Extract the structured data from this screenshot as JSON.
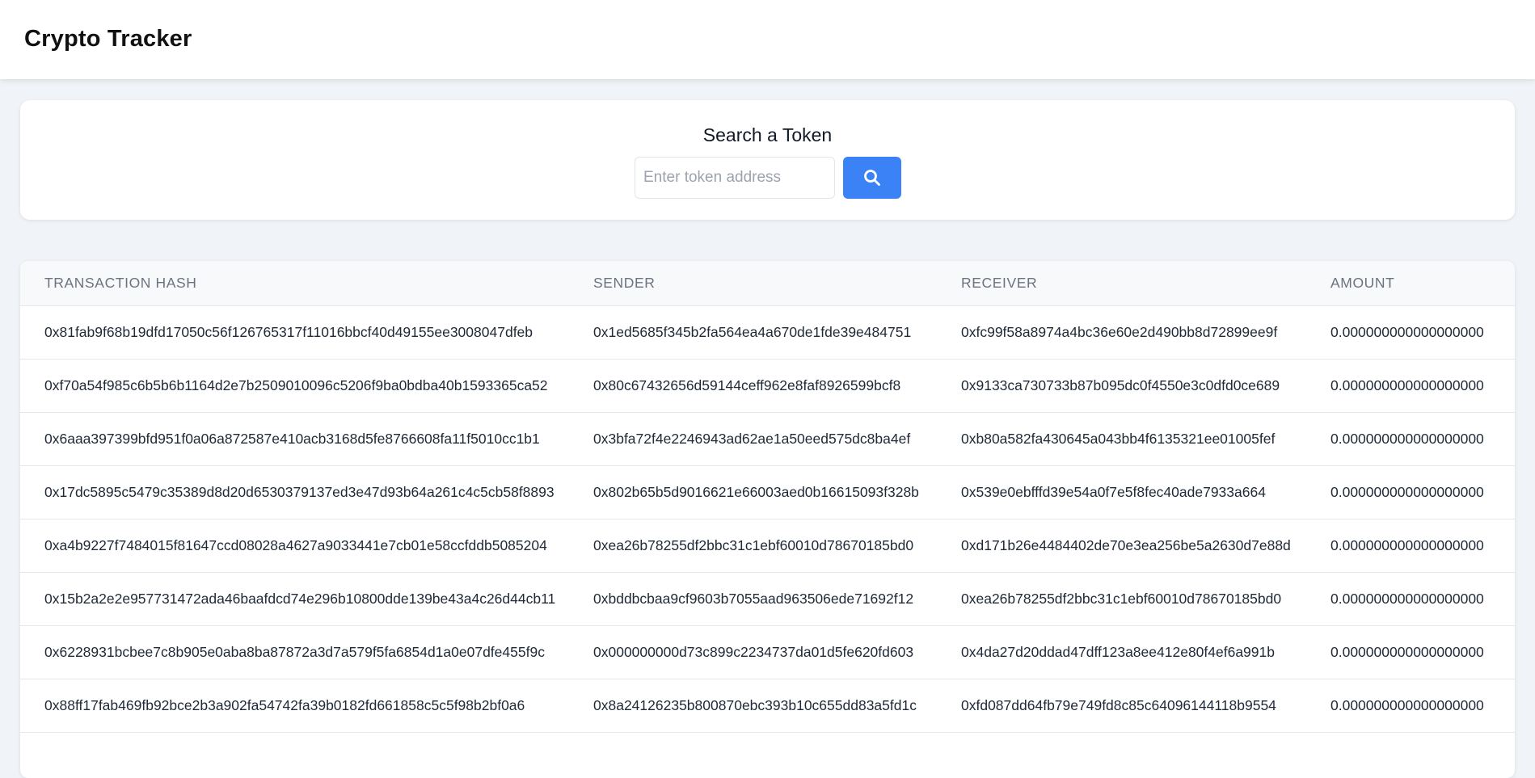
{
  "app": {
    "title": "Crypto Tracker"
  },
  "search": {
    "title": "Search a Token",
    "placeholder": "Enter token address",
    "value": "",
    "button_icon": "search-icon",
    "accent_color": "#3b82f6"
  },
  "table": {
    "columns": [
      "TRANSACTION HASH",
      "SENDER",
      "RECEIVER",
      "AMOUNT"
    ],
    "rows": [
      {
        "hash": "0x81fab9f68b19dfd17050c56f126765317f11016bbcf40d49155ee3008047dfeb",
        "sender": "0x1ed5685f345b2fa564ea4a670de1fde39e484751",
        "receiver": "0xfc99f58a8974a4bc36e60e2d490bb8d72899ee9f",
        "amount": "0.000000000000000000"
      },
      {
        "hash": "0xf70a54f985c6b5b6b1164d2e7b2509010096c5206f9ba0bdba40b1593365ca52",
        "sender": "0x80c67432656d59144ceff962e8faf8926599bcf8",
        "receiver": "0x9133ca730733b87b095dc0f4550e3c0dfd0ce689",
        "amount": "0.000000000000000000"
      },
      {
        "hash": "0x6aaa397399bfd951f0a06a872587e410acb3168d5fe8766608fa11f5010cc1b1",
        "sender": "0x3bfa72f4e2246943ad62ae1a50eed575dc8ba4ef",
        "receiver": "0xb80a582fa430645a043bb4f6135321ee01005fef",
        "amount": "0.000000000000000000"
      },
      {
        "hash": "0x17dc5895c5479c35389d8d20d6530379137ed3e47d93b64a261c4c5cb58f8893",
        "sender": "0x802b65b5d9016621e66003aed0b16615093f328b",
        "receiver": "0x539e0ebfffd39e54a0f7e5f8fec40ade7933a664",
        "amount": "0.000000000000000000"
      },
      {
        "hash": "0xa4b9227f7484015f81647ccd08028a4627a9033441e7cb01e58ccfddb5085204",
        "sender": "0xea26b78255df2bbc31c1ebf60010d78670185bd0",
        "receiver": "0xd171b26e4484402de70e3ea256be5a2630d7e88d",
        "amount": "0.000000000000000000"
      },
      {
        "hash": "0x15b2a2e2e957731472ada46baafdcd74e296b10800dde139be43a4c26d44cb11",
        "sender": "0xbddbcbaa9cf9603b7055aad963506ede71692f12",
        "receiver": "0xea26b78255df2bbc31c1ebf60010d78670185bd0",
        "amount": "0.000000000000000000"
      },
      {
        "hash": "0x6228931bcbee7c8b905e0aba8ba87872a3d7a579f5fa6854d1a0e07dfe455f9c",
        "sender": "0x000000000d73c899c2234737da01d5fe620fd603",
        "receiver": "0x4da27d20ddad47dff123a8ee412e80f4ef6a991b",
        "amount": "0.000000000000000000"
      },
      {
        "hash": "0x88ff17fab469fb92bce2b3a902fa54742fa39b0182fd661858c5c5f98b2bf0a6",
        "sender": "0x8a24126235b800870ebc393b10c655dd83a5fd1c",
        "receiver": "0xfd087dd64fb79e749fd8c85c64096144118b9554",
        "amount": "0.000000000000000000"
      }
    ]
  }
}
